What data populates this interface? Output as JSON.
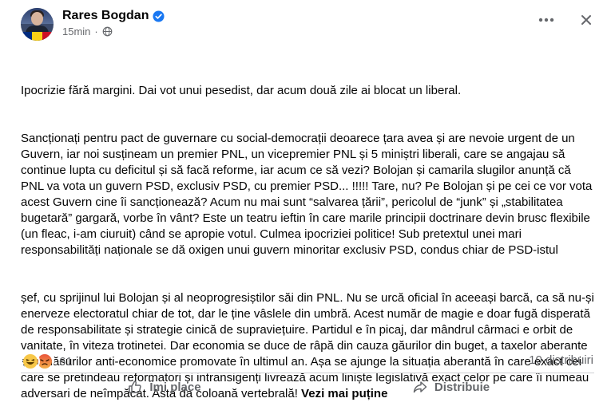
{
  "post": {
    "author": "Rares Bogdan",
    "timestamp": "15min",
    "paragraphs": [
      "Ipocrizie fără margini. Dai vot unui pesedist, dar acum două zile ai blocat un liberal.",
      "Sancționați pentru pact de guvernare cu social-democrații deoarece țara avea și are nevoie urgent de un Guvern, iar noi susțineam un premier PNL, un vicepremier PNL și 5 miniștri liberali, care se angajau să continue lupta cu deficitul și să facă reforme, iar acum ce să vezi? Bolojan și camarila slugilor anunță că PNL va vota un guvern PSD, exclusiv PSD, cu premier PSD... !!!!! Tare, nu? Pe Bolojan și pe cei ce vor vota acest Guvern cine îi sancționează? Acum nu mai sunt “salvarea țării”, pericolul de “junk” și „stabilitatea bugetară” gargară, vorbe în vânt? Este un teatru ieftin în care marile principii doctrinare devin brusc flexibile (un fleac, i-am ciuruit) când se apropie votul. Culmea ipocriziei politice! Sub pretextul unei mari responsabilități naționale se dă oxigen unui guvern minoritar exclusiv PSD, condus chiar de PSD-istul",
      "șef, cu sprijinul lui Bolojan și al neoprogresiștilor săi din PNL. Nu se urcă oficial în aceeași barcă, ca să nu-și enerveze electoratul chiar de tot, dar le ține vâslele din umbră. Acest număr de magie e doar fugă disperată de responsabilitate și strategie cinică de supraviețuire. Partidul e în picaj, dar mândrul cârmaci e orbit de vanitate, în viteza trotinetei. Dar economia se duce de râpă din cauza găurilor din buget, a taxelor aberante și a măsurilor anti-economice promovate în ultimul an. Așa se ajunge la situația aberantă în care exact cei care se pretindeau reformatori și intransigenți livrează acum liniște legislativă exact celor pe care îi numeau adversari de neîmpăcat. Asta da coloană vertebrală!"
    ],
    "see_less": "Vezi mai puține",
    "reaction_count": "61",
    "shares": "10 distribuiri",
    "like_label": "Îmi place",
    "share_label": "Distribuie"
  },
  "icons": {
    "verified": "verified-badge-icon",
    "audience": "globe-icon",
    "more": "more-options-icon",
    "close": "close-icon",
    "reactions": [
      "haha-reaction-icon",
      "angry-reaction-icon"
    ],
    "like": "thumbs-up-icon",
    "share": "share-arrow-icon"
  },
  "colors": {
    "verified_blue": "#1877f2",
    "secondary_text": "#65676b",
    "divider": "#ced0d4"
  }
}
